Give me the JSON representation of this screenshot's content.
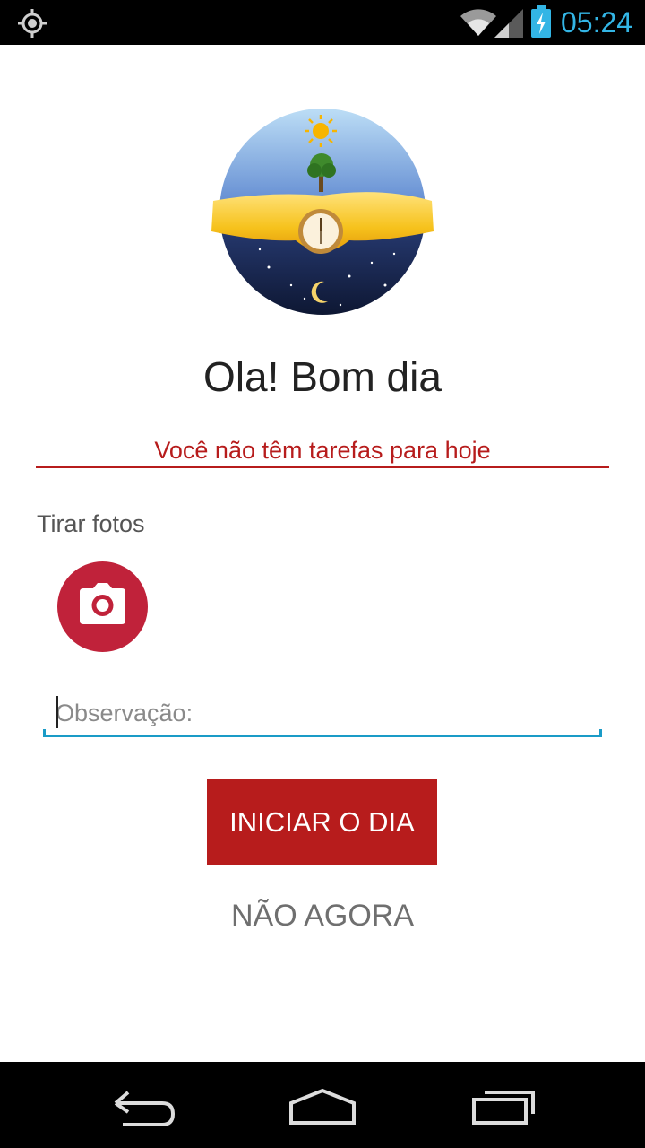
{
  "status_bar": {
    "time": "05:24",
    "icons": [
      "gps-icon",
      "wifi-icon",
      "signal-icon",
      "battery-charging-icon"
    ],
    "clock_color": "#33b5e5"
  },
  "logo": {
    "icon": "day-night-clock-logo"
  },
  "greeting": "Ola! Bom dia",
  "tasks_message": "Você não têm tarefas para hoje",
  "photos": {
    "label": "Tirar fotos",
    "icon": "camera-icon"
  },
  "observation": {
    "value": "",
    "placeholder": "Observação:"
  },
  "actions": {
    "start_label": "INICIAR O DIA",
    "not_now_label": "NÃO AGORA"
  },
  "nav_bar": {
    "icons": [
      "back-icon",
      "home-icon",
      "recents-icon"
    ]
  },
  "colors": {
    "accent": "#b71c1c",
    "camera_button": "#c0223a",
    "input_underline": "#1a9bc7"
  }
}
